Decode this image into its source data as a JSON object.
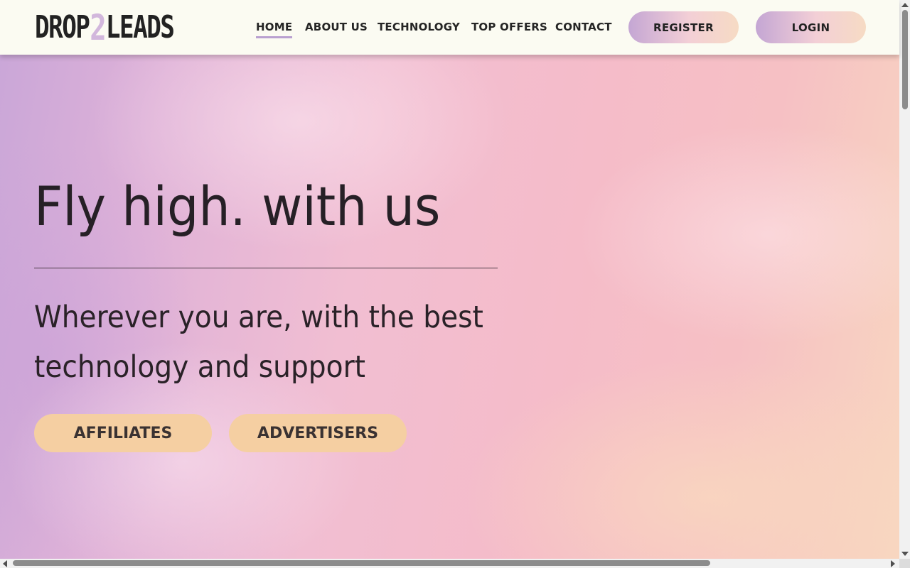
{
  "header": {
    "logo": {
      "part1": "DROP",
      "part2": "2",
      "part3": "LEADS"
    },
    "nav": [
      {
        "label": "HOME",
        "active": true
      },
      {
        "label": "ABOUT US"
      },
      {
        "label": "TECHNOLOGY"
      },
      {
        "label": "TOP OFFERS"
      },
      {
        "label": "CONTACT"
      }
    ],
    "register_label": "REGISTER",
    "login_label": "LOGIN"
  },
  "hero": {
    "headline": "Fly high. with us",
    "subline1": "Wherever you are, with the best",
    "subline2": "technology and support",
    "cta_affiliates": "AFFILIATES",
    "cta_advertisers": "ADVERTISERS"
  },
  "colors": {
    "header_bg": "#fbfbf2",
    "accent_underline": "#b9a0d0",
    "cta_bg": "#f5cfa2",
    "logo_two": "#d2b7dc"
  }
}
